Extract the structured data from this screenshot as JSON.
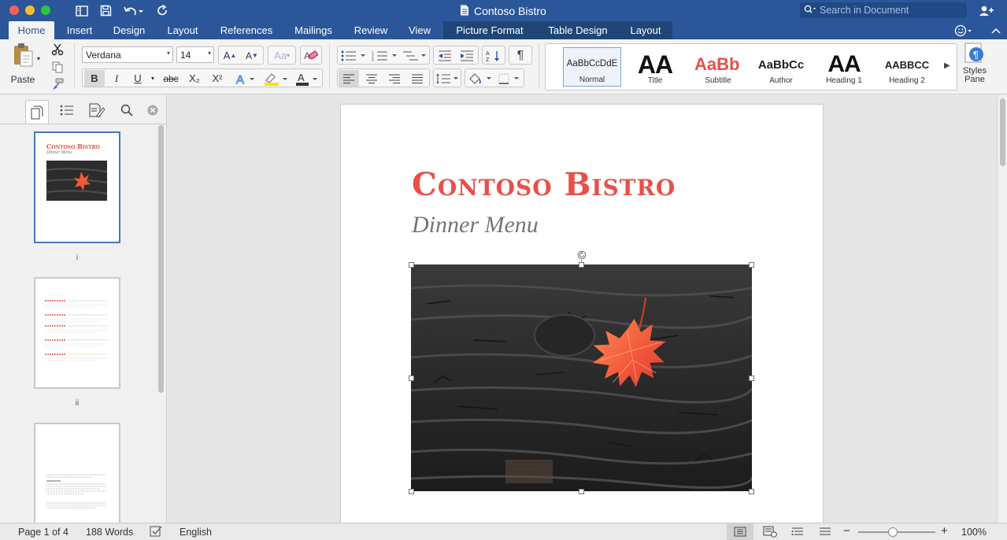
{
  "window": {
    "title": "Contoso Bistro"
  },
  "search": {
    "placeholder": "Search in Document"
  },
  "tabs": [
    "Home",
    "Insert",
    "Design",
    "Layout",
    "References",
    "Mailings",
    "Review",
    "View"
  ],
  "context_tabs": [
    "Picture Format",
    "Table Design",
    "Layout"
  ],
  "ribbon": {
    "paste_label": "Paste",
    "font_name": "Verdana",
    "font_size": "14",
    "styles": [
      {
        "name": "Normal",
        "preview": "AaBbCcDdE"
      },
      {
        "name": "Title",
        "preview": "AA"
      },
      {
        "name": "Subtitle",
        "preview": "AaBb"
      },
      {
        "name": "Author",
        "preview": "AaBbCc"
      },
      {
        "name": "Heading 1",
        "preview": "AA"
      },
      {
        "name": "Heading 2",
        "preview": "AABBCC"
      }
    ],
    "styles_pane_label": "Styles Pane",
    "format_buttons": {
      "bold": "B",
      "italic": "I",
      "underline": "U",
      "strike": "abc",
      "subscript": "X₂",
      "superscript": "X²"
    }
  },
  "sidebar": {
    "pages": [
      {
        "label": "i",
        "title": "Contoso Bistro",
        "sub": "Dinner Menu"
      },
      {
        "label": "ii"
      },
      {
        "label": ""
      }
    ]
  },
  "document": {
    "heading": "Contoso Bistro",
    "subheading": "Dinner Menu"
  },
  "status": {
    "page": "Page 1 of 4",
    "words": "188 Words",
    "language": "English",
    "zoom": "100%",
    "zoom_level": 0.45
  },
  "colors": {
    "brand": "#2b579a",
    "heading": "#e8504a"
  }
}
